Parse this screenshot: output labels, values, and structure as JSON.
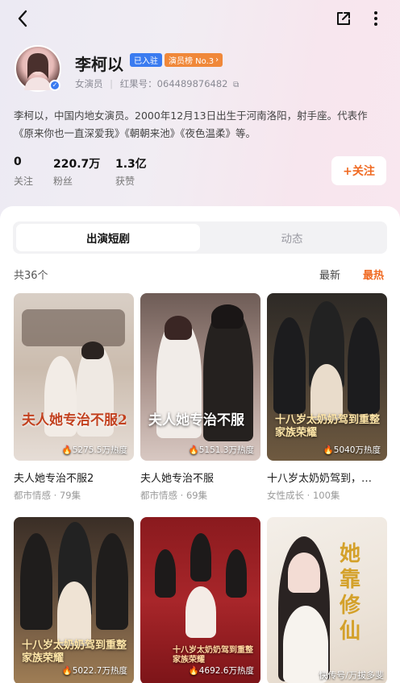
{
  "header": {
    "back_icon": "chevron-left-icon",
    "share_icon": "share-icon",
    "more_icon": "more-vertical-icon"
  },
  "profile": {
    "name": "李柯以",
    "verified_badge": "已入驻",
    "rank_badge": "演员榜 No.3",
    "role": "女演员",
    "id_label": "红果号：064489876482",
    "bio": "李柯以，中国内地女演员。2000年12月13日出生于河南洛阳，射手座。代表作《原来你也一直深爱我》《朝朝来池》《夜色温柔》等。",
    "follow_label": "+关注",
    "stats": [
      {
        "value": "0",
        "label": "关注"
      },
      {
        "value": "220.7万",
        "label": "粉丝"
      },
      {
        "value": "1.3亿",
        "label": "获赞"
      }
    ]
  },
  "tabs": [
    {
      "label": "出演短剧",
      "active": true
    },
    {
      "label": "动态",
      "active": false
    }
  ],
  "list": {
    "count_label": "共36个",
    "sort_latest": "最新",
    "sort_hottest": "最热"
  },
  "dramas": [
    {
      "poster_text": "夫人她专治不服2",
      "heat": "5275.5万热度",
      "title": "夫人她专治不服2",
      "sub": "都市情感 · 79集"
    },
    {
      "poster_text": "夫人她专治不服",
      "heat": "5151.3万热度",
      "title": "夫人她专治不服",
      "sub": "都市情感 · 69集"
    },
    {
      "poster_text": "十八岁太奶奶驾到重整家族荣耀",
      "heat": "5040万热度",
      "title": "十八岁太奶奶驾到，…",
      "sub": "女性成长 · 100集"
    },
    {
      "poster_text": "十八岁太奶奶驾到重整家族荣耀",
      "heat": "5022.7万热度",
      "title": "",
      "sub": ""
    },
    {
      "poster_text": "十八岁太奶奶驾到重整家族荣耀",
      "heat": "4692.6万热度",
      "title": "",
      "sub": ""
    },
    {
      "poster_text": "她靠修仙",
      "heat": "",
      "title": "",
      "sub": ""
    }
  ],
  "watermark": "快传号/万拔多斐",
  "colors": {
    "accent": "#f06a22",
    "verified": "#3a7bf0",
    "rank": "#f0883a"
  }
}
